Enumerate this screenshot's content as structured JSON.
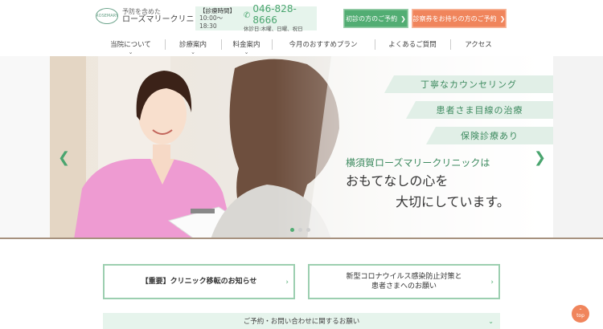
{
  "header": {
    "logo_mark": "ROSEMARY",
    "logo_sub": "予防を含めた",
    "logo_name": "ローズマリークリニック",
    "hours_label": "【診療時間】",
    "hours_time": "10:00〜18:30",
    "phone": "046-828-8666",
    "closed_days": "休診日:木曜、日曜、祝日",
    "first_visit_button": "初診の方のご予約",
    "ticket_button": "診察券をお持ちの方のご予約"
  },
  "nav": {
    "items": [
      {
        "label": "当院について",
        "chevron": "⌄"
      },
      {
        "label": "診療案内",
        "chevron": "⌄"
      },
      {
        "label": "料金案内",
        "chevron": "⌄"
      },
      {
        "label": "今月のおすすめプラン",
        "chevron": ""
      },
      {
        "label": "よくあるご質問",
        "chevron": ""
      },
      {
        "label": "アクセス",
        "chevron": ""
      }
    ]
  },
  "hero": {
    "tags": [
      "丁寧なカウンセリング",
      "患者さま目線の治療",
      "保険診療あり"
    ],
    "copy_line1": "横須賀ローズマリークリニックは",
    "copy_line2": "おもてなしの心を",
    "copy_line3": "大切にしています。",
    "prev_arrow": "❮",
    "next_arrow": "❯",
    "active_slide": 1,
    "slide_count": 3
  },
  "notices": {
    "left": "【重要】クリニック移転のお知らせ",
    "right_line1": "新型コロナウイルス感染防止対策と",
    "right_line2": "患者さまへのお願い",
    "chevron": "›"
  },
  "inquiry": {
    "label": "ご予約・お問い合わせに関するお願い",
    "chevron": "⌄"
  },
  "top_button": {
    "arrow": "⌃",
    "label": "top"
  },
  "colors": {
    "brand_green": "#52ad73",
    "accent_orange": "#f0855c",
    "light_green": "#e6f4ec"
  }
}
